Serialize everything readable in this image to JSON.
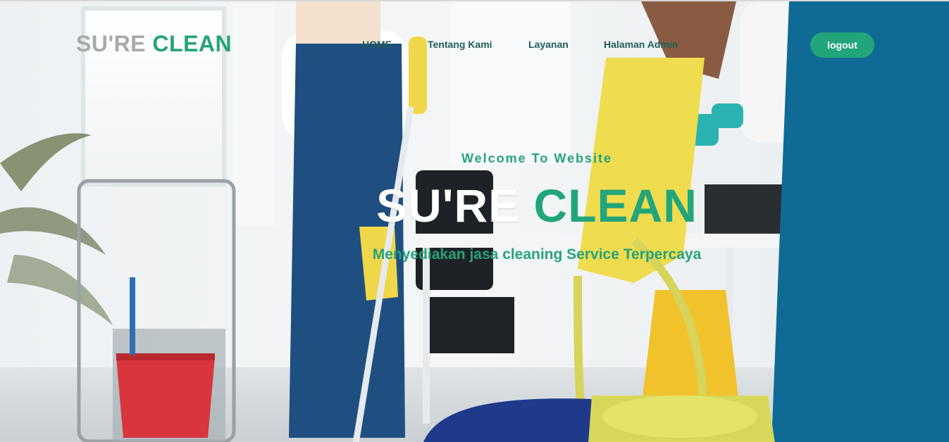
{
  "brand": {
    "part1": "SU'RE",
    "part2": "CLEAN"
  },
  "nav": {
    "items": [
      {
        "label": "HOME"
      },
      {
        "label": "Tentang Kami"
      },
      {
        "label": "Layanan"
      },
      {
        "label": "Halaman Admin"
      }
    ],
    "logout_label": "logout"
  },
  "hero": {
    "welcome": "Welcome To Website",
    "title_part1": "SU'RE",
    "title_part2": "CLEAN",
    "subtitle": "Menyediakan jasa cleaning Service Terpercaya"
  },
  "colors": {
    "accent": "#22a57b",
    "muted": "#a9a9a9",
    "nav_text": "#1f5e57"
  }
}
